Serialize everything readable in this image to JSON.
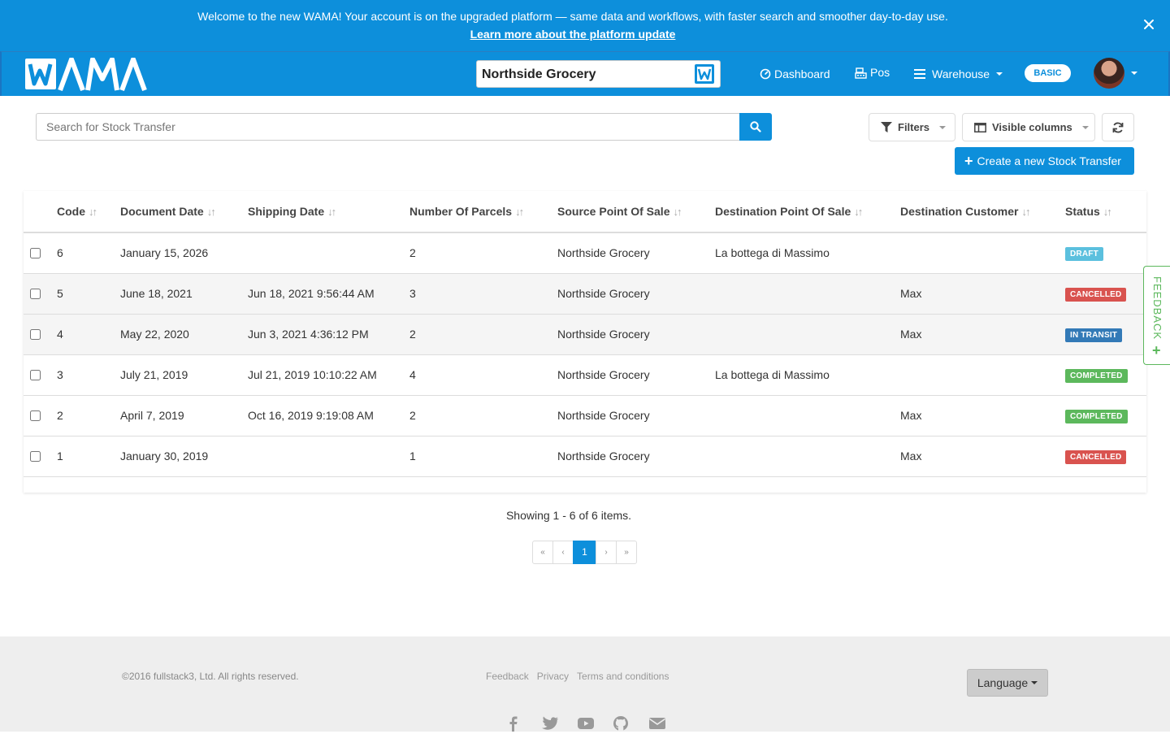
{
  "banner": {
    "message": "Welcome to the new WAMA! Your account is on the upgraded platform — same data and workflows, with faster search and smoother day-to-day use.",
    "link": "Learn more about the platform update",
    "close_icon": "close-icon"
  },
  "navbar": {
    "logo_text": "WAMA",
    "store_name": "Northside Grocery",
    "items": [
      {
        "label": "Dashboard",
        "icon": "dashboard-icon"
      },
      {
        "label": "Pos",
        "icon": "pos-icon"
      },
      {
        "label": "Warehouse",
        "icon": "menu-icon"
      }
    ],
    "plan_badge": "BASIC"
  },
  "toolbar": {
    "search_placeholder": "Search for Stock Transfer",
    "filters_label": "Filters",
    "columns_label": "Visible columns",
    "create_label": "Create a new Stock Transfer"
  },
  "table": {
    "headers": [
      "Code",
      "Document Date",
      "Shipping Date",
      "Number Of Parcels",
      "Source Point Of Sale",
      "Destination Point Of Sale",
      "Destination Customer",
      "Status"
    ],
    "rows": [
      {
        "code": "6",
        "doc_date": "January 15, 2026",
        "ship_date": "",
        "parcels": "2",
        "source": "Northside Grocery",
        "dest_pos": "La bottega di Massimo",
        "dest_customer": "",
        "status": "DRAFT",
        "status_color": "#5bc0de"
      },
      {
        "code": "5",
        "doc_date": "June 18, 2021",
        "ship_date": "Jun 18, 2021 9:56:44 AM",
        "parcels": "3",
        "source": "Northside Grocery",
        "dest_pos": "",
        "dest_customer": "Max",
        "status": "CANCELLED",
        "status_color": "#d9534f"
      },
      {
        "code": "4",
        "doc_date": "May 22, 2020",
        "ship_date": "Jun 3, 2021 4:36:12 PM",
        "parcels": "2",
        "source": "Northside Grocery",
        "dest_pos": "",
        "dest_customer": "Max",
        "status": "IN TRANSIT",
        "status_color": "#337ab7"
      },
      {
        "code": "3",
        "doc_date": "July 21, 2019",
        "ship_date": "Jul 21, 2019 10:10:22 AM",
        "parcels": "4",
        "source": "Northside Grocery",
        "dest_pos": "La bottega di Massimo",
        "dest_customer": "",
        "status": "COMPLETED",
        "status_color": "#5cb85c"
      },
      {
        "code": "2",
        "doc_date": "April 7, 2019",
        "ship_date": "Oct 16, 2019 9:19:08 AM",
        "parcels": "2",
        "source": "Northside Grocery",
        "dest_pos": "",
        "dest_customer": "Max",
        "status": "COMPLETED",
        "status_color": "#5cb85c"
      },
      {
        "code": "1",
        "doc_date": "January 30, 2019",
        "ship_date": "",
        "parcels": "1",
        "source": "Northside Grocery",
        "dest_pos": "",
        "dest_customer": "Max",
        "status": "CANCELLED",
        "status_color": "#d9534f"
      }
    ]
  },
  "feedback_tab": "FEEDBACK",
  "pagination": {
    "summary": "Showing 1 - 6 of 6 items.",
    "first": "«",
    "prev": "‹",
    "current": "1",
    "next": "›",
    "last": "»"
  },
  "footer": {
    "copyright": "©2016 fullstack3, Ltd. All rights reserved.",
    "links": [
      "Feedback",
      "Privacy",
      "Terms and conditions"
    ],
    "language_label": "Language",
    "socials": [
      "facebook-icon",
      "twitter-icon",
      "youtube-icon",
      "github-icon",
      "email-icon"
    ]
  },
  "colors": {
    "primary": "#0d8fdb",
    "success": "#5cb85c",
    "danger": "#d9534f",
    "info": "#5bc0de",
    "transit": "#337ab7"
  }
}
